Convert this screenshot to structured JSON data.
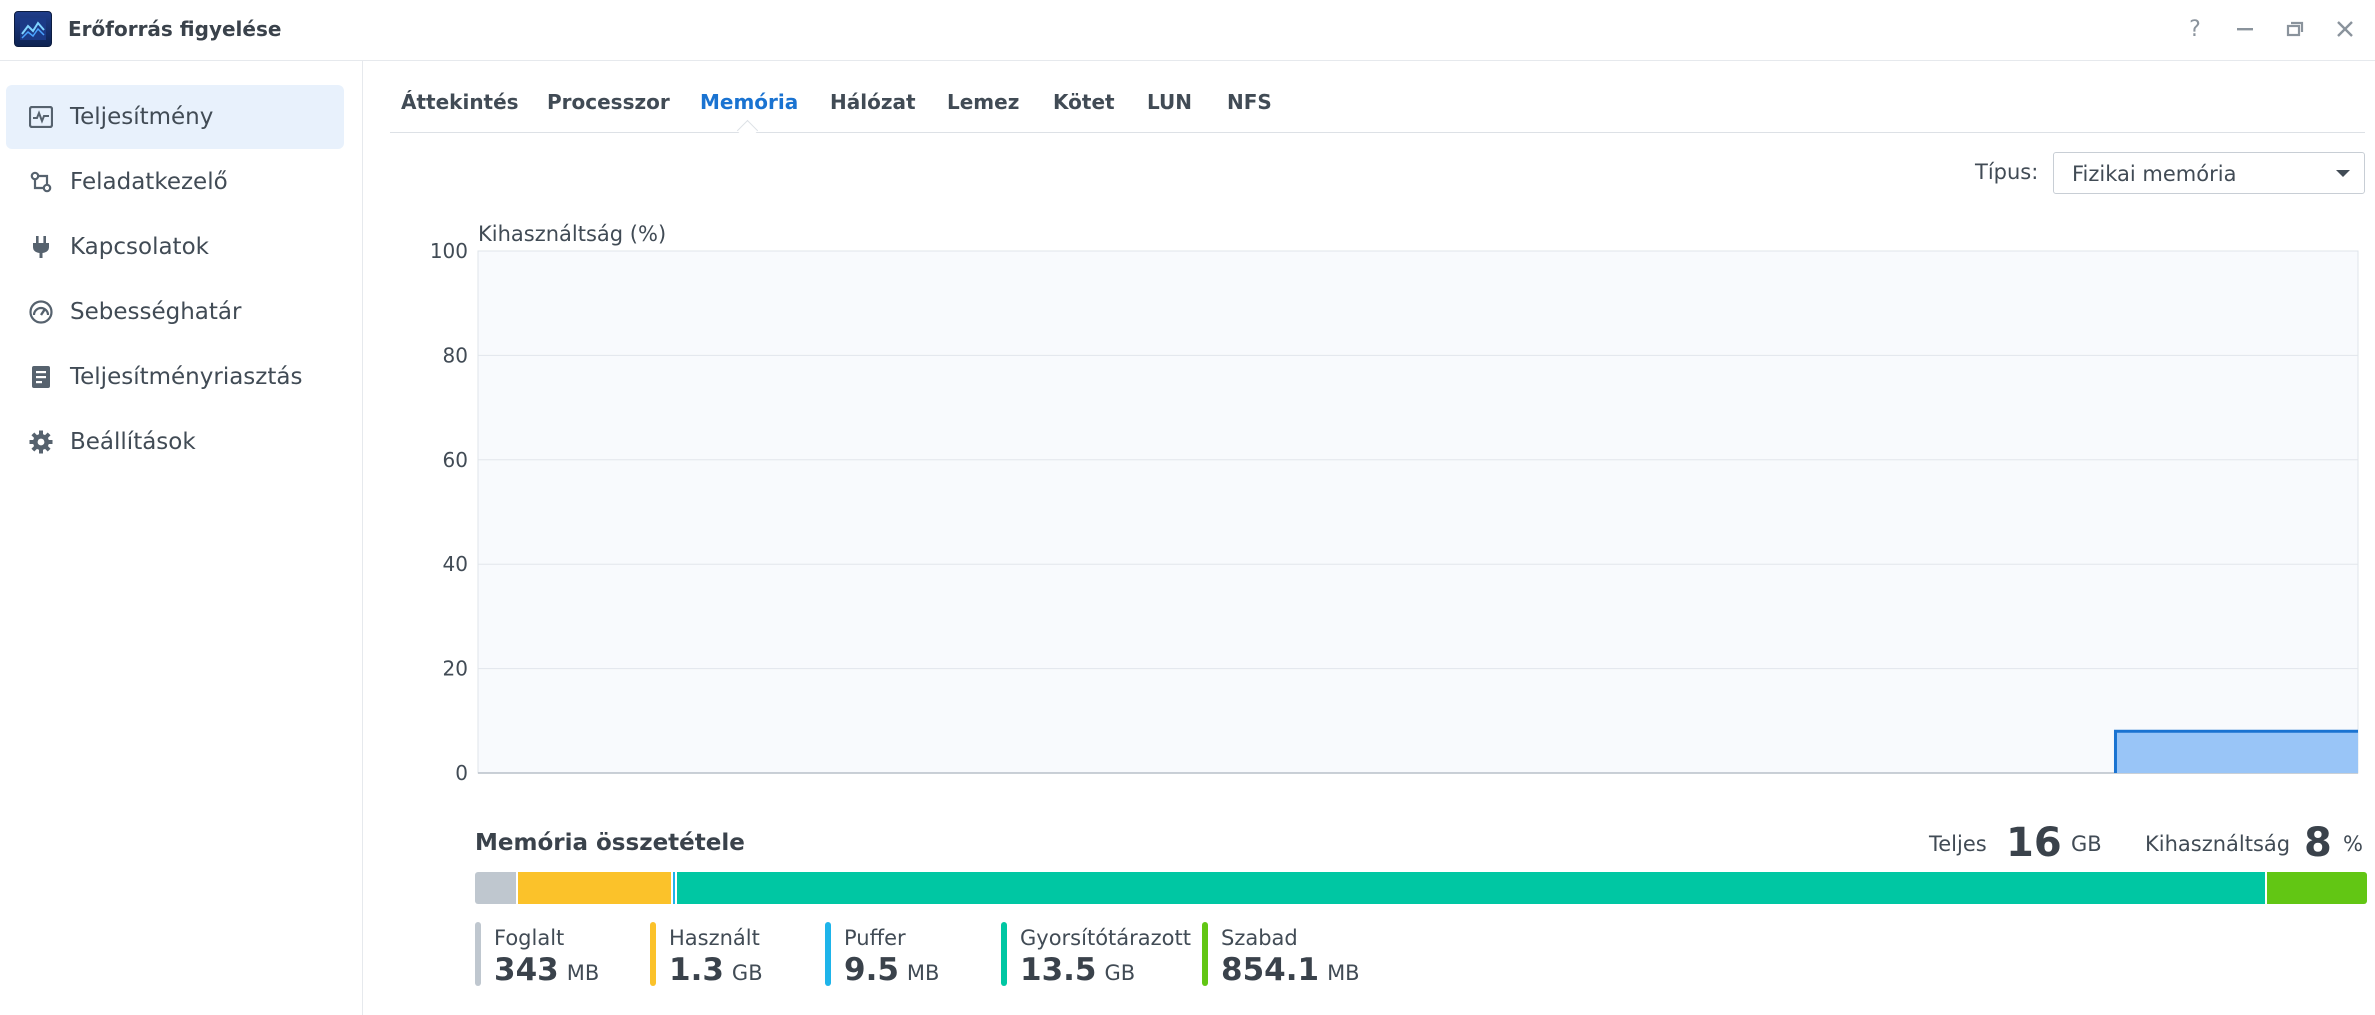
{
  "window": {
    "title": "Erőforrás figyelése",
    "controls": {
      "help": "?",
      "minimize": "—",
      "restore": "❐",
      "close": "✕"
    }
  },
  "sidebar": {
    "items": [
      {
        "label": "Teljesítmény",
        "icon": "performance-chart-icon",
        "active": true
      },
      {
        "label": "Feladatkezelő",
        "icon": "task-manager-icon",
        "active": false
      },
      {
        "label": "Kapcsolatok",
        "icon": "plug-icon",
        "active": false
      },
      {
        "label": "Sebességhatár",
        "icon": "speed-gauge-icon",
        "active": false
      },
      {
        "label": "Teljesítményriasztás",
        "icon": "alert-report-icon",
        "active": false
      },
      {
        "label": "Beállítások",
        "icon": "gear-icon",
        "active": false
      }
    ]
  },
  "tabs": [
    {
      "label": "Áttekintés",
      "active": false
    },
    {
      "label": "Processzor",
      "active": false
    },
    {
      "label": "Memória",
      "active": true
    },
    {
      "label": "Hálózat",
      "active": false
    },
    {
      "label": "Lemez",
      "active": false
    },
    {
      "label": "Kötet",
      "active": false
    },
    {
      "label": "LUN",
      "active": false
    },
    {
      "label": "NFS",
      "active": false
    }
  ],
  "type_select": {
    "label": "Típus:",
    "value": "Fizikai memória"
  },
  "chart_data": {
    "type": "area",
    "ylabel": "Kihasználtság (%)",
    "ylim": [
      0,
      100
    ],
    "yticks": [
      "100",
      "80",
      "60",
      "40",
      "20",
      "0"
    ],
    "grid": true,
    "x": [
      0,
      86.9,
      87.1,
      100
    ],
    "values": [
      null,
      null,
      8,
      8
    ],
    "fill_color": "#99c5f7",
    "line_color": "#1a73d1"
  },
  "composition": {
    "title": "Memória összetétele",
    "total_label": "Teljes",
    "total_value": "16",
    "total_unit": "GB",
    "usage_label": "Kihasználtság",
    "usage_value": "8",
    "usage_unit": "%",
    "segments": [
      {
        "name": "Foglalt",
        "value": "343",
        "unit": "MB",
        "color": "#bfc7cf",
        "share": 0.022
      },
      {
        "name": "Használt",
        "value": "1.3",
        "unit": "GB",
        "color": "#fbc22a",
        "share": 0.081
      },
      {
        "name": "Puffer",
        "value": "9.5",
        "unit": "MB",
        "color": "#1eb4ea",
        "share": 0.001
      },
      {
        "name": "Gyorsítótárazott",
        "value": "13.5",
        "unit": "GB",
        "color": "#00c7a3",
        "share": 0.843
      },
      {
        "name": "Szabad",
        "value": "854.1",
        "unit": "MB",
        "color": "#62c614",
        "share": 0.053
      }
    ]
  }
}
